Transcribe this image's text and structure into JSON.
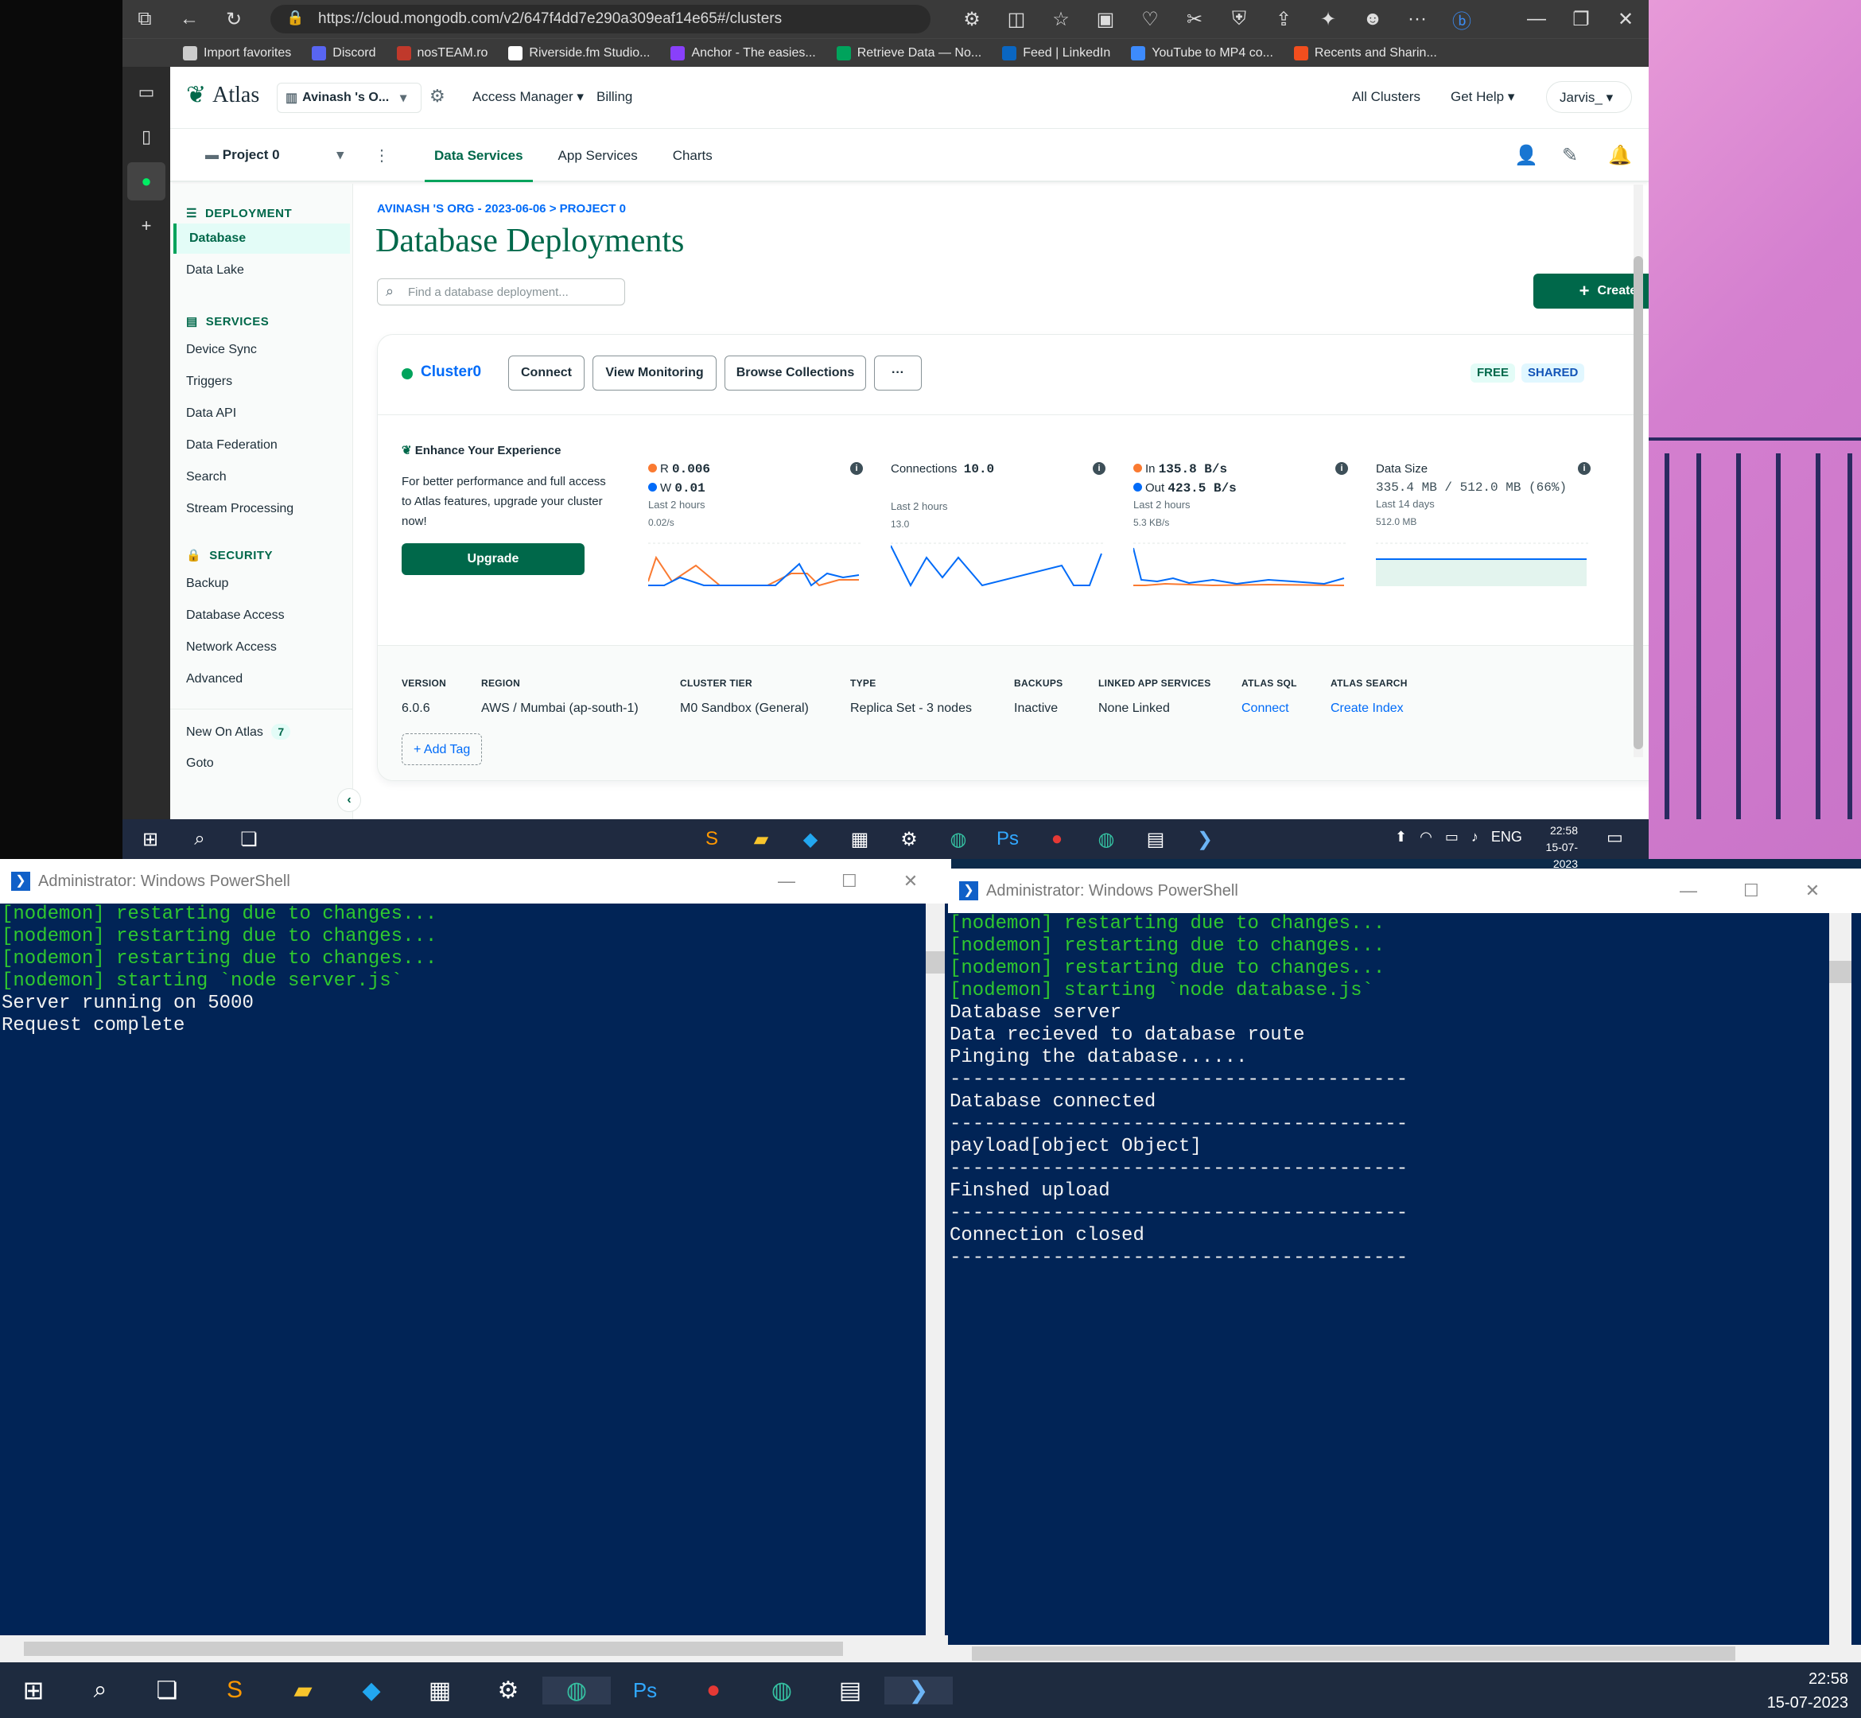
{
  "browser": {
    "url": "https://cloud.mongodb.com/v2/647f4dd7e290a309eaf14e65#/clusters",
    "favorites": [
      {
        "label": "Import favorites",
        "color": "#cccccc"
      },
      {
        "label": "Discord",
        "color": "#5865f2"
      },
      {
        "label": "nosTEAM.ro",
        "color": "#c0392b"
      },
      {
        "label": "Riverside.fm Studio...",
        "color": "#ffffff"
      },
      {
        "label": "Anchor - The easies...",
        "color": "#8940fa"
      },
      {
        "label": "Retrieve Data — No...",
        "color": "#00a35c"
      },
      {
        "label": "Feed | LinkedIn",
        "color": "#0a66c2"
      },
      {
        "label": "YouTube to MP4 co...",
        "color": "#3d8bfd"
      },
      {
        "label": "Recents and Sharin...",
        "color": "#f24e1e"
      }
    ]
  },
  "atlas": {
    "brand": "Atlas",
    "org": "Avinash 's O...",
    "nav": {
      "access_manager": "Access Manager",
      "billing": "Billing",
      "all_clusters": "All Clusters",
      "get_help": "Get Help",
      "user": "Jarvis_"
    },
    "project": "Project 0",
    "tabs": [
      "Data Services",
      "App Services",
      "Charts"
    ],
    "sidebar": {
      "deployment": "DEPLOYMENT",
      "deployment_items": [
        "Database",
        "Data Lake"
      ],
      "services": "SERVICES",
      "services_items": [
        "Device Sync",
        "Triggers",
        "Data API",
        "Data Federation",
        "Search",
        "Stream Processing"
      ],
      "security": "SECURITY",
      "security_items": [
        "Backup",
        "Database Access",
        "Network Access",
        "Advanced"
      ],
      "new_on_atlas": "New On Atlas",
      "new_count": "7",
      "goto": "Goto"
    },
    "breadcrumb": "AVINASH 'S ORG - 2023-06-06 > PROJECT 0",
    "title": "Database Deployments",
    "search_placeholder": "Find a database deployment...",
    "create": "Create",
    "cluster": {
      "name": "Cluster0",
      "buttons": [
        "Connect",
        "View Monitoring",
        "Browse Collections",
        "···"
      ],
      "badges": [
        "FREE",
        "SHARED"
      ],
      "enhance_title": "Enhance Your Experience",
      "enhance_text": "For better performance and full access to Atlas features, upgrade your cluster now!",
      "upgrade": "Upgrade",
      "metrics": [
        {
          "l1": "R",
          "v1": "0.006",
          "l2": "W",
          "v2": "0.01",
          "period": "Last 2 hours",
          "scale": "0.02/s"
        },
        {
          "l1": "Connections",
          "v1": "10.0",
          "period": "Last 2 hours",
          "scale": "13.0"
        },
        {
          "l1": "In",
          "v1": "135.8 B/s",
          "l2": "Out",
          "v2": "423.5 B/s",
          "period": "Last 2 hours",
          "scale": "5.3 KB/s"
        },
        {
          "l1": "Data Size",
          "v1": "335.4 MB / 512.0 MB (66%)",
          "period": "Last 14 days",
          "scale": "512.0 MB"
        }
      ],
      "details": [
        {
          "h": "VERSION",
          "v": "6.0.6"
        },
        {
          "h": "REGION",
          "v": "AWS / Mumbai (ap-south-1)"
        },
        {
          "h": "CLUSTER TIER",
          "v": "M0 Sandbox (General)"
        },
        {
          "h": "TYPE",
          "v": "Replica Set - 3 nodes"
        },
        {
          "h": "BACKUPS",
          "v": "Inactive"
        },
        {
          "h": "LINKED APP SERVICES",
          "v": "None Linked"
        },
        {
          "h": "ATLAS SQL",
          "v": "Connect"
        },
        {
          "h": "ATLAS SEARCH",
          "v": "Create Index"
        }
      ],
      "add_tag": "+ Add Tag"
    }
  },
  "taskbar_top": {
    "lang": "ENG",
    "time": "22:58",
    "date": "15-07-2023"
  },
  "taskbar_bottom": {
    "time": "22:58",
    "date": "15-07-2023"
  },
  "ps_left": {
    "title": "Administrator: Windows PowerShell",
    "green_lines": [
      "[nodemon] restarting due to changes...",
      "[nodemon] restarting due to changes...",
      "[nodemon] restarting due to changes...",
      "[nodemon] starting `node server.js`"
    ],
    "white_lines": [
      "Server running on 5000",
      "Request complete"
    ]
  },
  "ps_right": {
    "title": "Administrator: Windows PowerShell",
    "green_lines": [
      "[nodemon] restarting due to changes...",
      "[nodemon] restarting due to changes...",
      "[nodemon] restarting due to changes...",
      "[nodemon] starting `node database.js`"
    ],
    "white_lines": [
      "Database server",
      "Data recieved to database route",
      "Pinging the database......",
      "----------------------------------------",
      "Database connected",
      "----------------------------------------",
      "payload[object Object]",
      "----------------------------------------",
      "Finshed upload",
      "----------------------------------------",
      "Connection closed",
      "----------------------------------------"
    ]
  }
}
